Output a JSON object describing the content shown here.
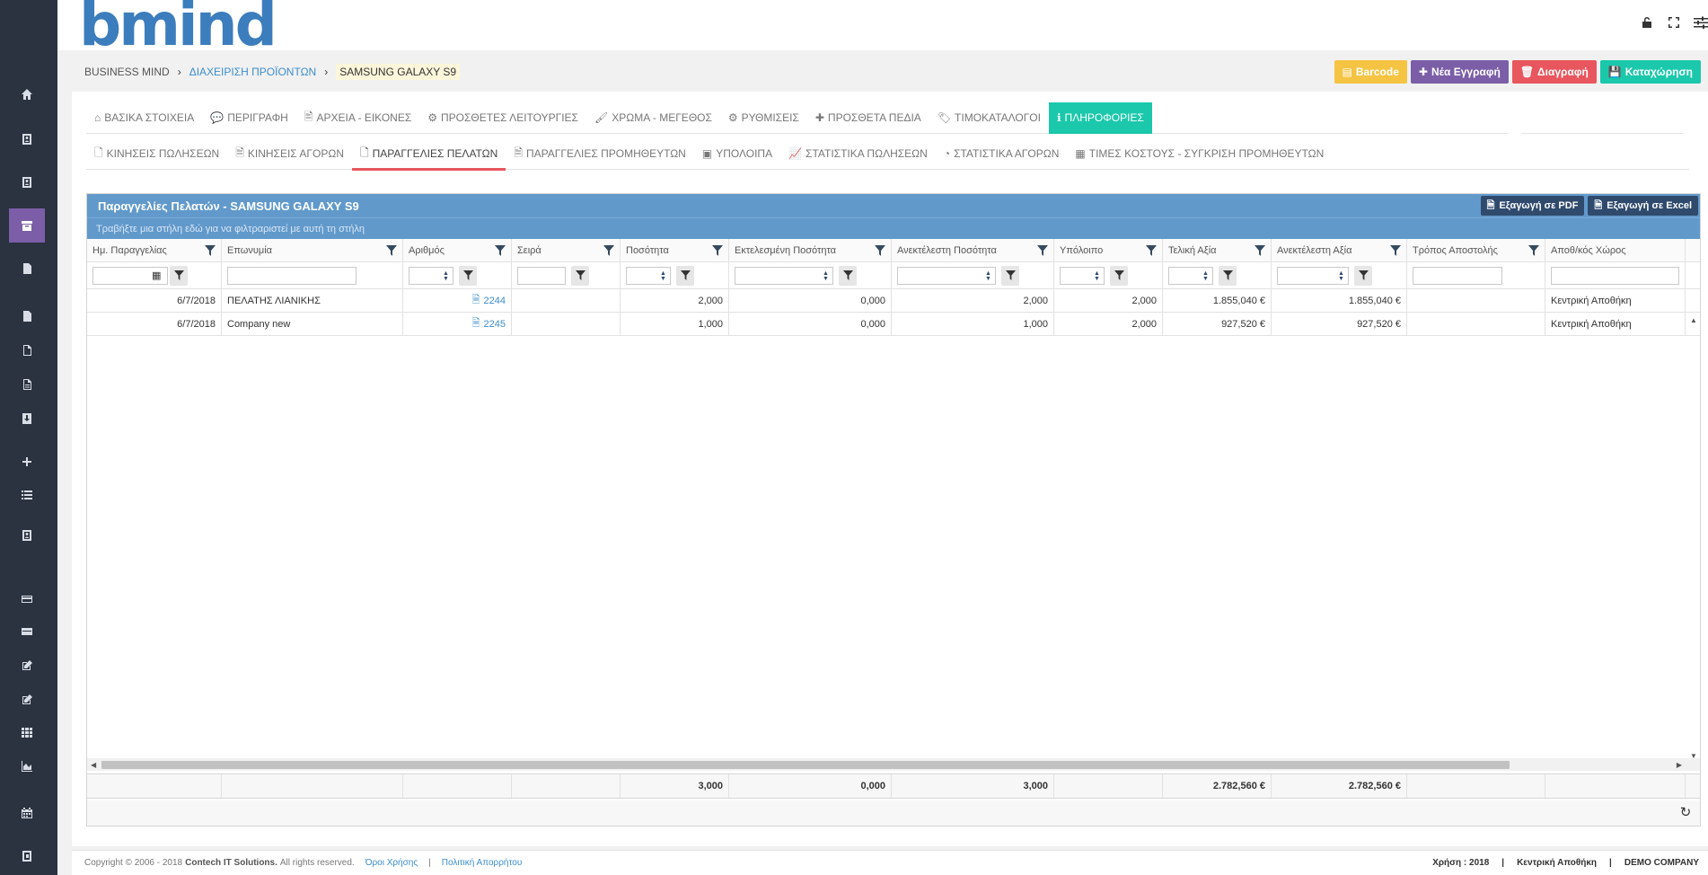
{
  "app": {
    "logo": "bmind"
  },
  "sidebar": {
    "items": [
      {
        "icon": "home-icon"
      },
      {
        "icon": "contact-card-icon"
      },
      {
        "icon": "contact-card-icon"
      },
      {
        "icon": "archive-box-icon",
        "active": true
      },
      {
        "icon": "document-icon"
      },
      {
        "icon": "document-icon"
      },
      {
        "icon": "document-outline-icon"
      },
      {
        "icon": "document-lines-icon"
      },
      {
        "icon": "contact-download-icon"
      },
      {
        "icon": "plus-icon"
      },
      {
        "icon": "list-icon"
      },
      {
        "icon": "contact-card-icon"
      },
      {
        "icon": "credit-card-icon"
      },
      {
        "icon": "credit-card-icon"
      },
      {
        "icon": "edit-icon"
      },
      {
        "icon": "edit-icon"
      },
      {
        "icon": "grid-icon"
      },
      {
        "icon": "area-chart-icon"
      },
      {
        "icon": "calendar-icon"
      },
      {
        "icon": "address-book-icon"
      }
    ]
  },
  "header": {
    "icons": [
      "unlock-icon",
      "fullscreen-icon",
      "sliders-icon"
    ]
  },
  "breadcrumb": {
    "home": "BUSINESS MIND",
    "section": "ΔΙΑΧΕΙΡΙΣΗ ΠΡΟΪΟΝΤΩΝ",
    "current": "SAMSUNG GALAXY S9"
  },
  "actions": {
    "barcode": "Barcode",
    "new": "Νέα Εγγραφή",
    "delete": "Διαγραφή",
    "save": "Καταχώρηση"
  },
  "tabs_main": [
    {
      "label": "ΒΑΣΙΚΑ ΣΤΟΙΧΕΙΑ",
      "icon": "home-icon"
    },
    {
      "label": "ΠΕΡΙΓΡΑΦΗ",
      "icon": "comments-icon"
    },
    {
      "label": "ΑΡΧΕΙΑ - ΕΙΚΟΝΕΣ",
      "icon": "image-file-icon"
    },
    {
      "label": "ΠΡΟΣΘΕΤΕΣ ΛΕΙΤΟΥΡΓΙΕΣ",
      "icon": "cogs-icon"
    },
    {
      "label": "ΧΡΩΜΑ - ΜΕΓΕΘΟΣ",
      "icon": "brush-icon"
    },
    {
      "label": "ΡΥΘΜΙΣΕΙΣ",
      "icon": "gear-icon"
    },
    {
      "label": "ΠΡΟΣΘΕΤΑ ΠΕΔΙΑ",
      "icon": "plus-icon"
    },
    {
      "label": "ΤΙΜΟΚΑΤΑΛΟΓΟΙ",
      "icon": "tag-icon"
    },
    {
      "label": "ΠΛΗΡΟΦΟΡΙΕΣ",
      "icon": "info-icon",
      "active": true
    }
  ],
  "tabs_sub": [
    {
      "label": "ΚΙΝΗΣΕΙΣ ΠΩΛΗΣΕΩΝ",
      "icon": "document-outline-icon"
    },
    {
      "label": "ΚΙΝΗΣΕΙΣ ΑΓΟΡΩΝ",
      "icon": "document-icon"
    },
    {
      "label": "ΠΑΡΑΓΓΕΛΙΕΣ ΠΕΛΑΤΩΝ",
      "icon": "document-outline-icon",
      "active": true
    },
    {
      "label": "ΠΑΡΑΓΓΕΛΙΕΣ ΠΡΟΜΗΘΕΥΤΩΝ",
      "icon": "document-icon"
    },
    {
      "label": "ΥΠΟΛΟΙΠΑ",
      "icon": "inbox-icon"
    },
    {
      "label": "ΣΤΑΤΙΣΤΙΚΑ ΠΩΛΗΣΕΩΝ",
      "icon": "line-chart-icon"
    },
    {
      "label": "ΣΤΑΤΙΣΤΙΚΑ ΑΓΟΡΩΝ",
      "icon": "pie-chart-icon"
    },
    {
      "label": "ΤΙΜΕΣ ΚΟΣΤΟΥΣ - ΣΥΓΚΡΙΣΗ ΠΡΟΜΗΘΕΥΤΩΝ",
      "icon": "calculator-icon"
    }
  ],
  "grid": {
    "title": "Παραγγελίες Πελατών - SAMSUNG GALAXY S9",
    "export_pdf": "Εξαγωγή σε PDF",
    "export_excel": "Εξαγωγή σε Excel",
    "group_hint": "Τραβήξτε μια στήλη εδώ για να φιλτραριστεί με αυτή τη στήλη",
    "columns": [
      "Ημ. Παραγγελίας",
      "Επωνυμία",
      "Αριθμός",
      "Σειρά",
      "Ποσότητα",
      "Εκτελεσμένη Ποσότητα",
      "Ανεκτέλεστη Ποσότητα",
      "Υπόλοιπο",
      "Τελική Αξία",
      "Ανεκτέλεστη Αξία",
      "Τρόπος Αποστολής",
      "Αποθ/κός Χώρος"
    ],
    "rows": [
      [
        "6/7/2018",
        "ΠΕΛΑΤΗΣ ΛΙΑΝΙΚΗΣ",
        "2244",
        "",
        "2,000",
        "0,000",
        "2,000",
        "2,000",
        "1.855,040 €",
        "1.855,040 €",
        "",
        "Κεντρική Αποθήκη"
      ],
      [
        "6/7/2018",
        "Company new",
        "2245",
        "",
        "1,000",
        "0,000",
        "1,000",
        "2,000",
        "927,520 €",
        "927,520 €",
        "",
        "Κεντρική Αποθήκη"
      ]
    ],
    "totals": [
      "",
      "",
      "",
      "",
      "3,000",
      "0,000",
      "3,000",
      "",
      "2.782,560 €",
      "2.782,560 €",
      "",
      ""
    ]
  },
  "footer": {
    "copyright_pre": "Copyright © 2006 - 2018",
    "company": "Contech IT Solutions.",
    "rights": "All rights reserved.",
    "terms": "Όροι Χρήσης",
    "sep": "|",
    "privacy": "Πολιτική Απορρήτου",
    "year": "Χρήση : 2018",
    "warehouse": "Κεντρική Αποθήκη",
    "company_demo": "DEMO COMPANY"
  }
}
